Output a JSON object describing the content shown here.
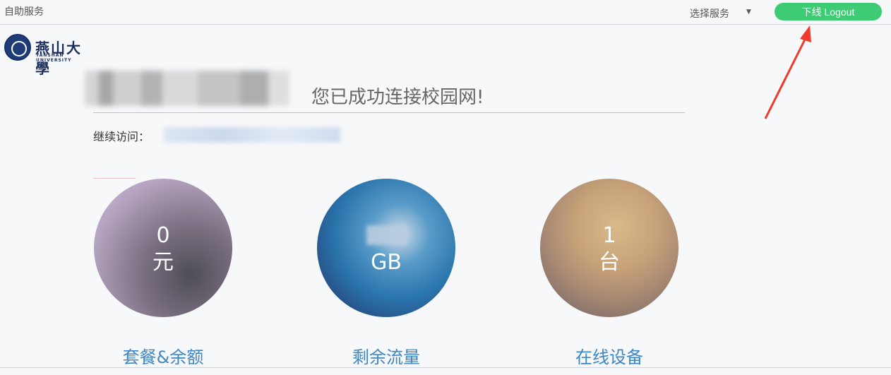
{
  "header": {
    "brand": "自助服务",
    "service_select": "选择服务",
    "logout_label": "下线 Logout"
  },
  "logo": {
    "cn": "燕山大學",
    "en": "YANSHAN UNIVERSITY"
  },
  "main": {
    "success_message": "您已成功连接校园网!",
    "continue_label": "继续访问："
  },
  "stats": [
    {
      "value": "0",
      "unit": "元",
      "caption": "套餐&余额"
    },
    {
      "value": "",
      "unit": "GB",
      "caption": "剩余流量"
    },
    {
      "value": "1",
      "unit": "台",
      "caption": "在线设备"
    }
  ],
  "colors": {
    "logout_button": "#3dcb74",
    "caption_text": "#3f86c2",
    "annotation_arrow": "#f23a2a"
  }
}
